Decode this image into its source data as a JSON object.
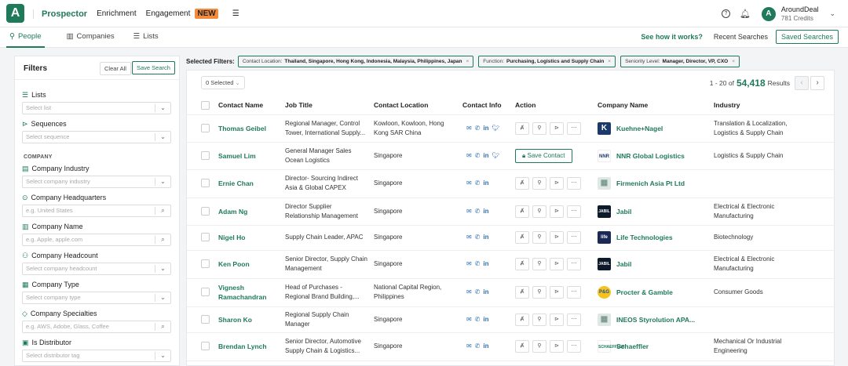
{
  "app": {
    "logo_text": "A",
    "nav": [
      "Prospector",
      "Enrichment",
      "Engagement"
    ],
    "new_badge": "NEW",
    "user_initial": "A",
    "user_name": "AroundDeal",
    "credits": "781 Credits"
  },
  "tabs": [
    "People",
    "Companies",
    "Lists"
  ],
  "subbar": {
    "see_how": "See how it works?",
    "recent": "Recent Searches",
    "saved": "Saved Searches"
  },
  "sidebar": {
    "title": "Filters",
    "clear_all": "Clear All",
    "save_search": "Save Search",
    "company_section": "COMPANY",
    "filters": [
      {
        "label": "Lists",
        "placeholder": "Select list",
        "icon": "list-icon",
        "kind": "select"
      },
      {
        "label": "Sequences",
        "placeholder": "Select sequence",
        "icon": "send-icon",
        "kind": "select"
      },
      {
        "label": "Company Industry",
        "placeholder": "Select company industry",
        "icon": "chart-icon",
        "kind": "select"
      },
      {
        "label": "Company Headquarters",
        "placeholder": "e.g. United States",
        "icon": "location-icon",
        "kind": "search"
      },
      {
        "label": "Company Name",
        "placeholder": "e.g. Apple, apple.com",
        "icon": "building-icon",
        "kind": "search"
      },
      {
        "label": "Company Headcount",
        "placeholder": "Select company headcount",
        "icon": "people-icon",
        "kind": "select"
      },
      {
        "label": "Company Type",
        "placeholder": "Select company type",
        "icon": "grid-icon",
        "kind": "select"
      },
      {
        "label": "Company Specialties",
        "placeholder": "e.g. AWS, Adobe, Glass, Coffee",
        "icon": "tag-icon",
        "kind": "search"
      },
      {
        "label": "Is Distributor",
        "placeholder": "Select distributor tag",
        "icon": "distributor-icon",
        "kind": "select"
      }
    ]
  },
  "filters_bar": {
    "label": "Selected Filters:",
    "chips": [
      {
        "key": "Contact Location:",
        "value": "Thailand, Singapore, Hong Kong, Indonesia, Malaysia, Philippines, Japan"
      },
      {
        "key": "Function:",
        "value": "Purchasing, Logistics and Supply Chain"
      },
      {
        "key": "Seniority Level:",
        "value": "Manager, Director, VP, CXO"
      }
    ]
  },
  "results": {
    "selected": "0 Selected",
    "range": "1 - 20 of",
    "total": "54,418",
    "suffix": "Results",
    "columns": [
      "Contact Name",
      "Job Title",
      "Contact Location",
      "Contact Info",
      "Action",
      "Company Name",
      "Industry"
    ],
    "save_contact": "Save Contact",
    "rows": [
      {
        "name": "Thomas Geibel",
        "title": [
          "Regional Manager, Control",
          "Tower, International Supply..."
        ],
        "location": [
          "Kowloon, Kowloon, Hong",
          "Kong SAR China"
        ],
        "icons": "mpit",
        "saved": false,
        "logo": "K",
        "logo_bg": "#1b3a6b",
        "logo_fg": "#ffffff",
        "company": "Kuehne+Nagel",
        "industry": [
          "Translation & Localization,",
          "Logistics & Supply Chain"
        ]
      },
      {
        "name": "Samuel Lim",
        "title": [
          "General Manager Sales",
          "Ocean Logistics"
        ],
        "location": [
          "Singapore"
        ],
        "icons": "mpit",
        "saved": true,
        "logo": "NNR",
        "logo_bg": "#ffffff",
        "logo_fg": "#1b3a6b",
        "company": "NNR Global Logistics",
        "industry": [
          "Logistics & Supply Chain"
        ]
      },
      {
        "name": "Ernie Chan",
        "title": [
          "Director- Sourcing Indirect",
          "Asia & Global CAPEX"
        ],
        "location": [
          "Singapore"
        ],
        "icons": "mpi",
        "saved": false,
        "logo": "▦",
        "logo_bg": "#dfe8e4",
        "logo_fg": "#7a9a8c",
        "company": "Firmenich Asia Pt Ltd",
        "industry": [
          ""
        ]
      },
      {
        "name": "Adam Ng",
        "title": [
          "Director Supplier",
          "Relationship Management"
        ],
        "location": [
          "Singapore"
        ],
        "icons": "mpi",
        "saved": false,
        "logo": "JABIL",
        "logo_bg": "#0c1a2b",
        "logo_fg": "#ffffff",
        "company": "Jabil",
        "industry": [
          "Electrical & Electronic",
          "Manufacturing"
        ]
      },
      {
        "name": "Nigel Ho",
        "title": [
          "Supply Chain Leader, APAC"
        ],
        "location": [
          "Singapore"
        ],
        "icons": "mpi",
        "saved": false,
        "logo": "life",
        "logo_bg": "#1b2a55",
        "logo_fg": "#ffffff",
        "company": "Life Technologies",
        "industry": [
          "Biotechnology"
        ]
      },
      {
        "name": "Ken Poon",
        "title": [
          "Senior Director, Supply Chain",
          "Management"
        ],
        "location": [
          "Singapore"
        ],
        "icons": "mpi",
        "saved": false,
        "logo": "JABIL",
        "logo_bg": "#0c1a2b",
        "logo_fg": "#ffffff",
        "company": "Jabil",
        "industry": [
          "Electrical & Electronic",
          "Manufacturing"
        ]
      },
      {
        "name": "Vignesh Ramachandran",
        "title": [
          "Head of Purchases -",
          "Regional Brand Building,..."
        ],
        "location": [
          "National Capital Region,",
          "Philippines"
        ],
        "icons": "mpi",
        "saved": false,
        "logo": "P&G",
        "logo_bg": "#f6c21c",
        "logo_fg": "#1b4fa3",
        "company": "Procter & Gamble",
        "industry": [
          "Consumer Goods"
        ]
      },
      {
        "name": "Sharon Ko",
        "title": [
          "Regional Supply Chain",
          "Manager"
        ],
        "location": [
          "Singapore"
        ],
        "icons": "mpi",
        "saved": false,
        "logo": "▦",
        "logo_bg": "#dfe8e4",
        "logo_fg": "#7a9a8c",
        "company": "INEOS Styrolution APA...",
        "industry": [
          ""
        ]
      },
      {
        "name": "Brendan Lynch",
        "title": [
          "Senior Director, Automotive",
          "Supply Chain & Logistics..."
        ],
        "location": [
          "Singapore"
        ],
        "icons": "mpi",
        "saved": false,
        "logo": "SCHAEFFLER",
        "logo_bg": "#ffffff",
        "logo_fg": "#1f7a5a",
        "company": "Schaeffler",
        "industry": [
          "Mechanical Or Industrial",
          "Engineering"
        ]
      }
    ]
  }
}
